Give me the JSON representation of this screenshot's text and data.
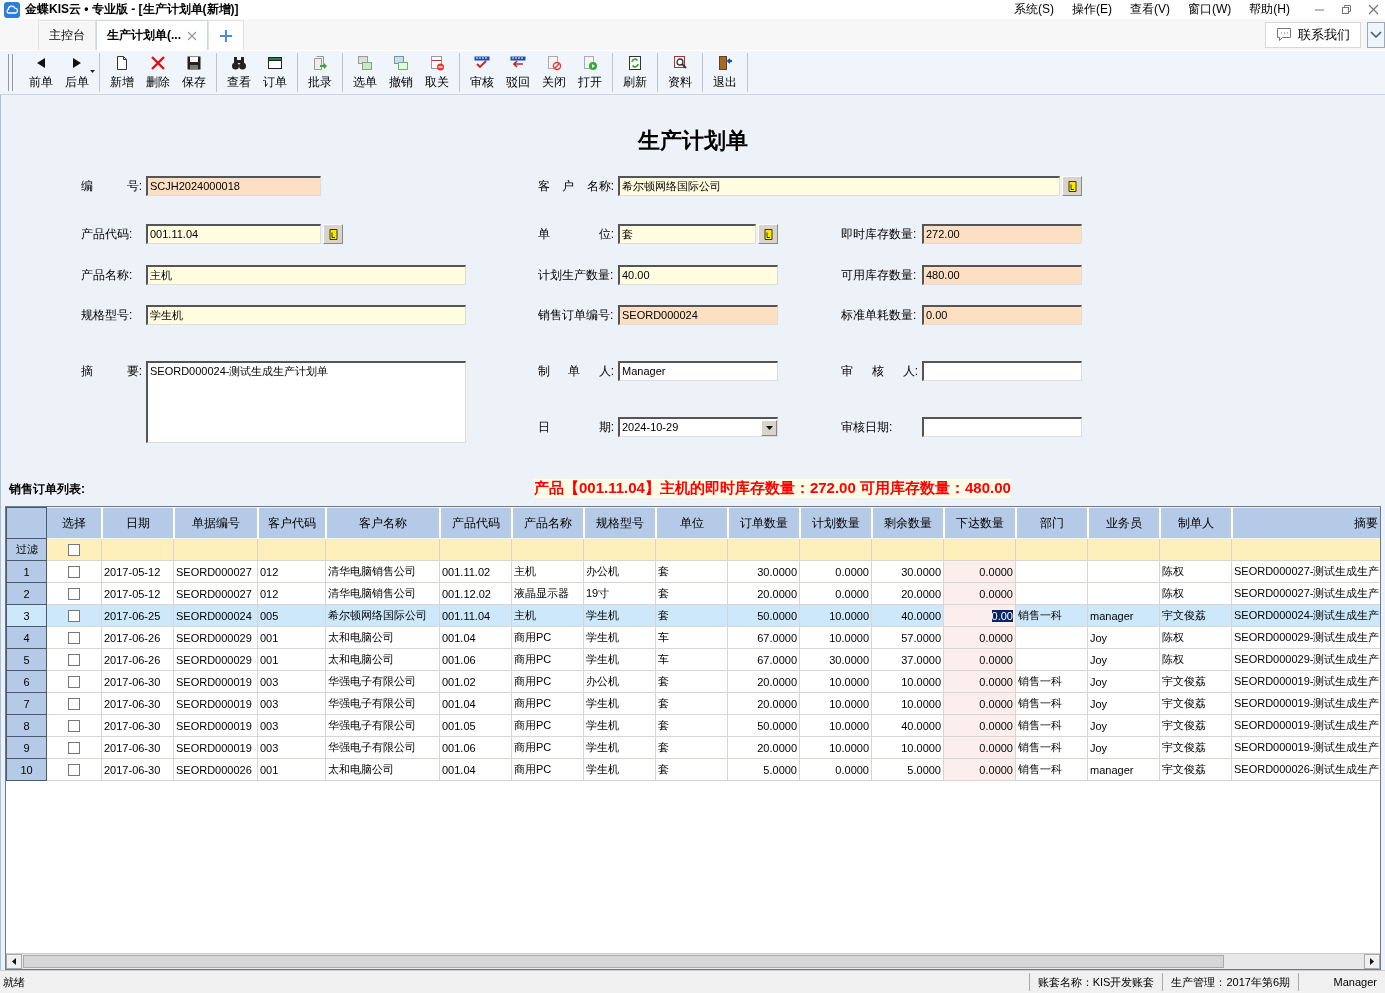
{
  "window": {
    "title": "金蝶KIS云 • 专业版 - [生产计划单(新增)]"
  },
  "menu": [
    "系统(S)",
    "操作(E)",
    "查看(V)",
    "窗口(W)",
    "帮助(H)"
  ],
  "tabs": [
    {
      "label": "主控台",
      "selected": false
    },
    {
      "label": "生产计划单(...",
      "selected": true
    }
  ],
  "contact_button": "联系我们",
  "toolbar": [
    [
      {
        "label": "前单",
        "dropdown": false
      },
      {
        "label": "后单",
        "dropdown": true
      }
    ],
    [
      {
        "label": "新增",
        "dropdown": false
      },
      {
        "label": "删除",
        "dropdown": false
      },
      {
        "label": "保存",
        "dropdown": false
      }
    ],
    [
      {
        "label": "查看",
        "dropdown": false
      },
      {
        "label": "订单",
        "dropdown": false
      }
    ],
    [
      {
        "label": "批录",
        "dropdown": false
      }
    ],
    [
      {
        "label": "选单",
        "dropdown": false
      },
      {
        "label": "撤销",
        "dropdown": false
      },
      {
        "label": "取关",
        "dropdown": false
      }
    ],
    [
      {
        "label": "审核",
        "dropdown": false
      },
      {
        "label": "驳回",
        "dropdown": false
      },
      {
        "label": "关闭",
        "dropdown": false
      },
      {
        "label": "打开",
        "dropdown": false
      }
    ],
    [
      {
        "label": "刷新",
        "dropdown": false
      }
    ],
    [
      {
        "label": "资料",
        "dropdown": false
      }
    ],
    [
      {
        "label": "退出",
        "dropdown": false
      }
    ]
  ],
  "form": {
    "title": "生产计划单",
    "fields": [
      {
        "label": "编 号:",
        "value": "SCJH2024000018",
        "color": "#fde0c4",
        "kind": "text"
      },
      {
        "label": "客 户 名称:",
        "value": "希尔顿网络国际公司",
        "color": "#fffde0",
        "kind": "lookup"
      },
      {
        "label": "产品代码:",
        "value": "001.11.04",
        "color": "#fffde0",
        "kind": "lookup"
      },
      {
        "label": "单 位:",
        "value": "套",
        "color": "#fffde0",
        "kind": "lookup"
      },
      {
        "label": "即时库存数量:",
        "value": "272.00",
        "color": "#fde0c4",
        "kind": "text"
      },
      {
        "label": "产品名称:",
        "value": "主机",
        "color": "#fffde0",
        "kind": "text"
      },
      {
        "label": "计划生产数量:",
        "value": "40.00",
        "color": "#fffde0",
        "kind": "text"
      },
      {
        "label": "可用库存数量:",
        "value": "480.00",
        "color": "#fde0c4",
        "kind": "text"
      },
      {
        "label": "规格型号:",
        "value": "学生机",
        "color": "#fffde0",
        "kind": "text"
      },
      {
        "label": "销售订单编号:",
        "value": "SEORD000024",
        "color": "#fde0c4",
        "kind": "text"
      },
      {
        "label": "标准单耗数量:",
        "value": "0.00",
        "color": "#fde0c4",
        "kind": "text"
      },
      {
        "label": "摘 要:",
        "value": "SEORD000024-测试生成生产计划单",
        "color": "#ffffff",
        "kind": "textarea"
      },
      {
        "label": "制 单 人:",
        "value": "Manager",
        "color": "#ffffff",
        "kind": "text"
      },
      {
        "label": "审 核 人:",
        "color": "#ffffff",
        "kind": "text"
      },
      {
        "label": "日 期:",
        "value": "2024-10-29",
        "color": "#ffffff",
        "kind": "date"
      },
      {
        "label": "审核日期:",
        "color": "#ffffff",
        "kind": "text"
      }
    ]
  },
  "list_title": "销售订单列表:",
  "stock_note": "产品【001.11.04】主机的即时库存数量：272.00 可用库存数量：480.00",
  "table": {
    "check_column": "选择",
    "columns": [
      {
        "label": "日期"
      },
      {
        "label": "单据编号"
      },
      {
        "label": "客户代码"
      },
      {
        "label": "客户名称"
      },
      {
        "label": "产品代码"
      },
      {
        "label": "产品名称"
      },
      {
        "label": "规格型号"
      },
      {
        "label": "单位"
      },
      {
        "label": "订单数量",
        "kind": "number"
      },
      {
        "label": "计划数量",
        "kind": "number"
      },
      {
        "label": "剩余数量",
        "kind": "number"
      },
      {
        "label": "下达数量",
        "kind": "entry"
      },
      {
        "label": "部门"
      },
      {
        "label": "业务员"
      },
      {
        "label": "制单人"
      },
      {
        "label": "摘要"
      }
    ],
    "filter": {
      "label": "过滤",
      "checked": false
    },
    "rows": [
      {
        "number": "1",
        "checked": false,
        "selected": false,
        "editing": false,
        "cells": [
          "2017-05-12",
          "SEORD000027",
          "012",
          "清华电脑销售公司",
          "001.11.02",
          "主机",
          "办公机",
          "套",
          "30.0000",
          "0.0000",
          "30.0000",
          "0.0000",
          null,
          null,
          "陈权",
          "SEORD000027-测试生成生产"
        ]
      },
      {
        "number": "2",
        "checked": false,
        "selected": false,
        "editing": false,
        "cells": [
          "2017-05-12",
          "SEORD000027",
          "012",
          "清华电脑销售公司",
          "001.12.02",
          "液晶显示器",
          "19寸",
          "套",
          "20.0000",
          "0.0000",
          "20.0000",
          "0.0000",
          null,
          null,
          "陈权",
          "SEORD000027-测试生成生产"
        ]
      },
      {
        "number": "3",
        "checked": false,
        "selected": true,
        "editing": true,
        "cells": [
          "2017-06-25",
          "SEORD000024",
          "005",
          "希尔顿网络国际公司",
          "001.11.04",
          "主机",
          "学生机",
          "套",
          "50.0000",
          "10.0000",
          "40.0000",
          "0.00",
          "销售一科",
          "manager",
          "宇文俊荔",
          "SEORD000024-测试生成生产"
        ]
      },
      {
        "number": "4",
        "checked": false,
        "selected": false,
        "editing": false,
        "cells": [
          "2017-06-26",
          "SEORD000029",
          "001",
          "太和电脑公司",
          "001.04",
          "商用PC",
          "学生机",
          "车",
          "67.0000",
          "10.0000",
          "57.0000",
          "0.0000",
          null,
          "Joy",
          "陈权",
          "SEORD000029-测试生成生产"
        ]
      },
      {
        "number": "5",
        "checked": false,
        "selected": false,
        "editing": false,
        "cells": [
          "2017-06-26",
          "SEORD000029",
          "001",
          "太和电脑公司",
          "001.06",
          "商用PC",
          "学生机",
          "车",
          "67.0000",
          "30.0000",
          "37.0000",
          "0.0000",
          null,
          "Joy",
          "陈权",
          "SEORD000029-测试生成生产"
        ]
      },
      {
        "number": "6",
        "checked": false,
        "selected": false,
        "editing": false,
        "cells": [
          "2017-06-30",
          "SEORD000019",
          "003",
          "华强电子有限公司",
          "001.02",
          "商用PC",
          "办公机",
          "套",
          "20.0000",
          "10.0000",
          "10.0000",
          "0.0000",
          "销售一科",
          "Joy",
          "宇文俊荔",
          "SEORD000019-测试生成生产"
        ]
      },
      {
        "number": "7",
        "checked": false,
        "selected": false,
        "editing": false,
        "cells": [
          "2017-06-30",
          "SEORD000019",
          "003",
          "华强电子有限公司",
          "001.04",
          "商用PC",
          "学生机",
          "套",
          "20.0000",
          "10.0000",
          "10.0000",
          "0.0000",
          "销售一科",
          "Joy",
          "宇文俊荔",
          "SEORD000019-测试生成生产"
        ]
      },
      {
        "number": "8",
        "checked": false,
        "selected": false,
        "editing": false,
        "cells": [
          "2017-06-30",
          "SEORD000019",
          "003",
          "华强电子有限公司",
          "001.05",
          "商用PC",
          "学生机",
          "套",
          "50.0000",
          "10.0000",
          "40.0000",
          "0.0000",
          "销售一科",
          "Joy",
          "宇文俊荔",
          "SEORD000019-测试生成生产"
        ]
      },
      {
        "number": "9",
        "checked": false,
        "selected": false,
        "editing": false,
        "cells": [
          "2017-06-30",
          "SEORD000019",
          "003",
          "华强电子有限公司",
          "001.06",
          "商用PC",
          "学生机",
          "套",
          "20.0000",
          "10.0000",
          "10.0000",
          "0.0000",
          "销售一科",
          "Joy",
          "宇文俊荔",
          "SEORD000019-测试生成生产"
        ]
      },
      {
        "number": "10",
        "checked": false,
        "selected": false,
        "editing": false,
        "cells": [
          "2017-06-30",
          "SEORD000026",
          "001",
          "太和电脑公司",
          "001.04",
          "商用PC",
          "学生机",
          "套",
          "5.0000",
          "0.0000",
          "5.0000",
          "0.0000",
          "销售一科",
          "manager",
          "宇文俊荔",
          "SEORD000026-测试生成生产"
        ]
      }
    ]
  },
  "status_bar": {
    "left": "就绪",
    "items": [
      "账套名称：KIS开发账套",
      "生产管理：2017年第6期",
      "Manager"
    ]
  }
}
